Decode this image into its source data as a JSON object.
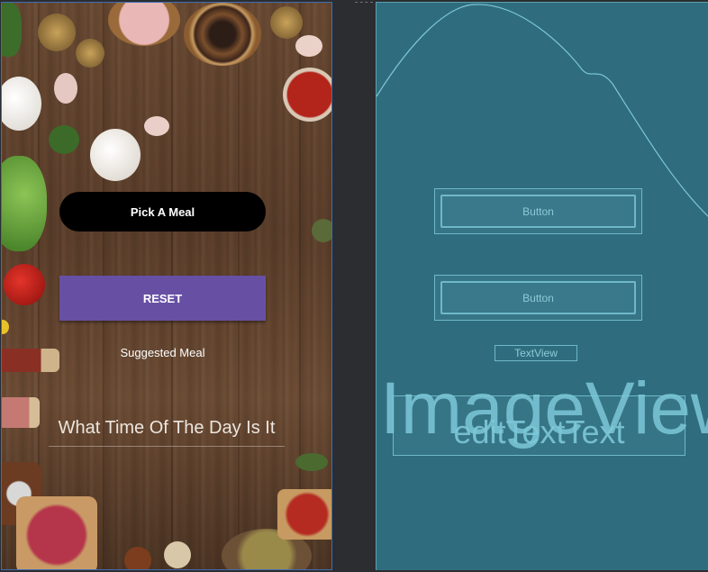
{
  "design": {
    "pick_button": "Pick A Meal",
    "reset_button": "RESET",
    "suggested_label": "Suggested Meal",
    "time_input_placeholder": "What Time Of The Day Is It"
  },
  "blueprint": {
    "button1": "Button",
    "button2": "Button",
    "textview": "TextView",
    "imageview": "ImageView",
    "edittext": "editTextText"
  },
  "colors": {
    "pick_button_bg": "#000000",
    "reset_button_bg": "#6750a4",
    "blueprint_bg": "#2f6d7e",
    "blueprint_line": "#6fb8c9"
  }
}
